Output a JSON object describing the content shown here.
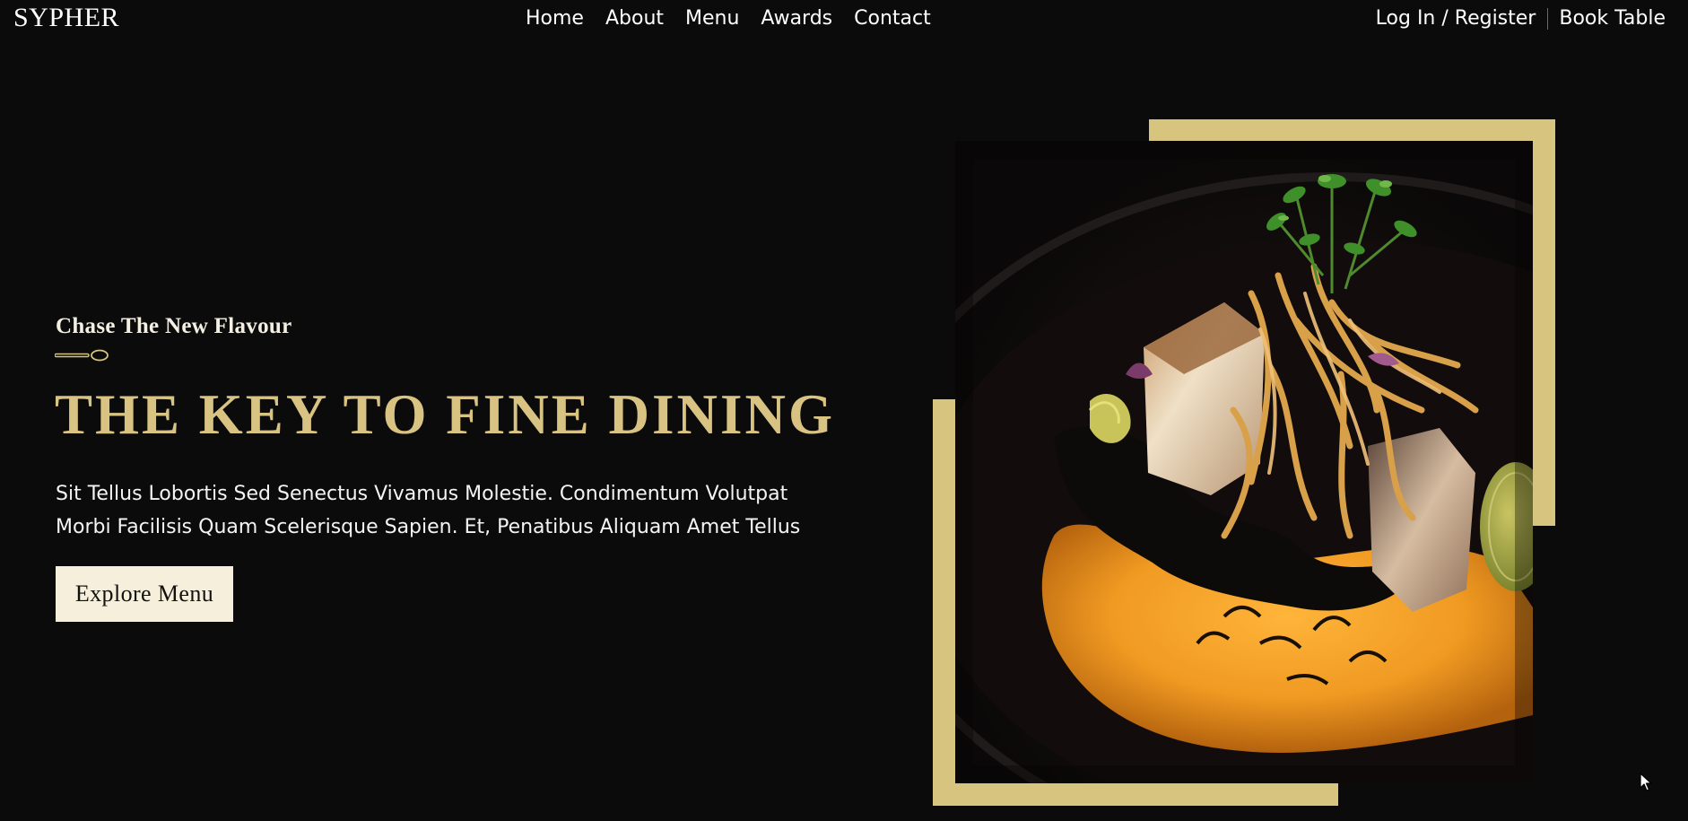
{
  "header": {
    "brand": "SYPHER",
    "nav": [
      "Home",
      "About",
      "Menu",
      "Awards",
      "Contact"
    ],
    "login_label": "Log In / Register",
    "book_label": "Book Table"
  },
  "hero": {
    "tagline": "Chase The New Flavour",
    "headline": "THE KEY TO FINE DINING",
    "description": "Sit Tellus Lobortis Sed Senectus Vivamus Molestie. Condimentum Volutpat Morbi Facilisis Quam Scelerisque Sapien. Et, Penatibus Aliquam Amet Tellus",
    "cta_label": "Explore Menu"
  },
  "icons": {
    "divider": "spoon-icon",
    "pointer": "cursor-icon"
  },
  "colors": {
    "background": "#0b0b0b",
    "accent_gold": "#d7c47f",
    "cta_background": "#f6efdc"
  }
}
